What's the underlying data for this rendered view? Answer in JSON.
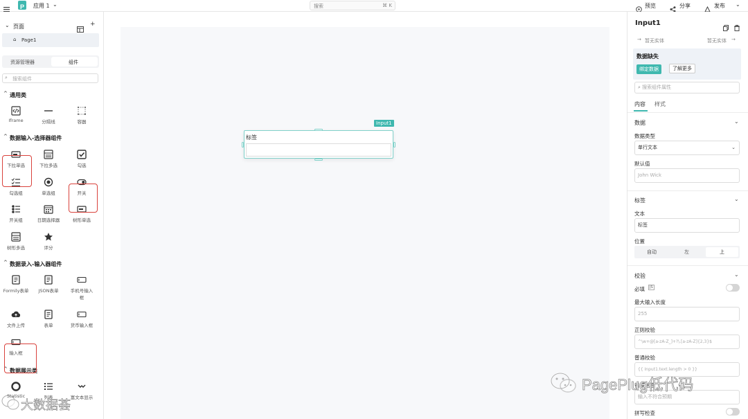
{
  "topbar": {
    "app_name": "应用 1",
    "search_placeholder": "搜索",
    "search_shortcut": "⌘ K",
    "preview": "预览",
    "share": "分享",
    "publish": "发布"
  },
  "left": {
    "pages_header": "页面",
    "page_item": "Page1",
    "tab_resources": "资源管理器",
    "tab_components": "组件",
    "search_placeholder": "搜索组件",
    "sections": {
      "general": "通用类",
      "selectors": "数据输入-选择器组件",
      "inputs": "数据录入-输入器组件",
      "display": "数据展示类"
    },
    "general_items": [
      "Iframe",
      "分隔线",
      "容器"
    ],
    "selector_items": [
      "下拉单选",
      "下拉多选",
      "勾选",
      "勾选组",
      "单选组",
      "开关",
      "开关组",
      "日期选择器",
      "树形单选",
      "树形多选",
      "评分"
    ],
    "input_items": [
      "Formily表单",
      "JSON表单",
      "手机号输入",
      "框",
      "文件上传",
      "表单",
      "货币输入框",
      "输入框"
    ],
    "display_items": [
      "Statistic",
      "列表",
      "富文本显示"
    ]
  },
  "canvas": {
    "widget_badge": "Input1",
    "widget_label": "标签"
  },
  "right": {
    "title": "Input1",
    "nav_prev": "暂无实体",
    "nav_next": "暂无实体",
    "alert_title": "数据缺失",
    "bind_button": "绑定数据",
    "learn_more": "了解更多",
    "search_placeholder": "搜索组件属性",
    "tab_content": "内容",
    "tab_style": "样式",
    "data_section": "数据",
    "data_type_label": "数据类型",
    "data_type_value": "单行文本",
    "default_label": "默认值",
    "default_placeholder": "John Wick",
    "label_section": "标签",
    "text_label": "文本",
    "text_value": "标签",
    "position_label": "位置",
    "positions": [
      "自动",
      "左",
      "上"
    ],
    "validate_section": "校验",
    "required_label": "必填",
    "js_badge": "JS",
    "max_length_label": "最大输入长度",
    "max_length_placeholder": "255",
    "regex_label": "正则校验",
    "regex_placeholder": "^\\w+@[a-zA-Z_]+?\\.[a-zA-Z]{2,3}$",
    "common_label": "普通校验",
    "common_placeholder": "{{ Input1.text.length > 0 }}",
    "error_label": "错误信息",
    "error_placeholder": "输入不符合预期",
    "spell_label": "拼写检查"
  },
  "watermark": {
    "left_text": "大数据荟",
    "right_text": "PagePlug低代码"
  },
  "colors": {
    "brand": "#3fb8af",
    "highlight": "#d9413b",
    "alert_bg": "#eef2f7"
  }
}
